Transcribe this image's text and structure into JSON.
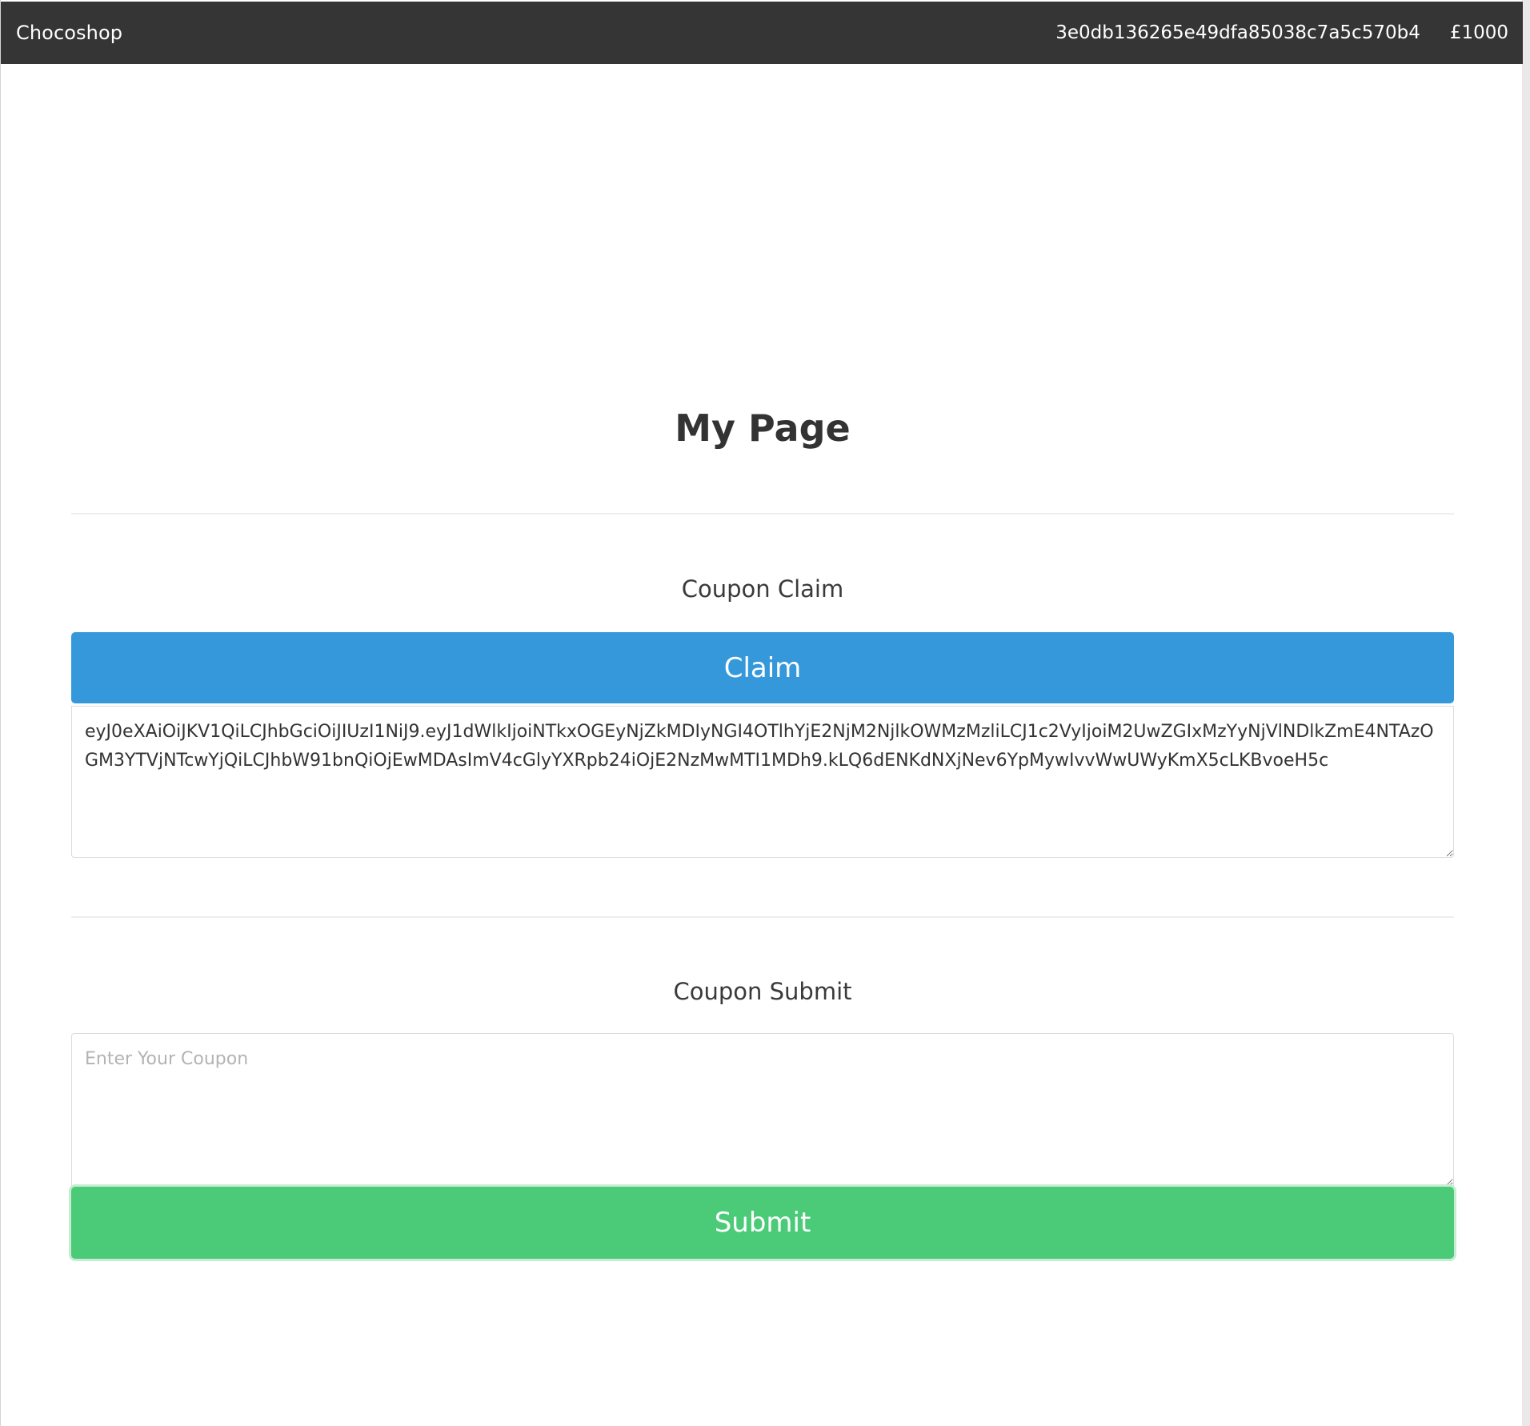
{
  "navbar": {
    "brand": "Chocoshop",
    "user_id": "3e0db136265e49dfa85038c7a5c570b4",
    "balance": "£1000"
  },
  "main": {
    "title": "My Page",
    "claim_section": {
      "heading": "Coupon Claim",
      "button_label": "Claim",
      "token_value": "eyJ0eXAiOiJKV1QiLCJhbGciOiJIUzI1NiJ9.eyJ1dWlkIjoiNTkxOGEyNjZkMDIyNGI4OTlhYjE2NjM2NjlkOWMzMzliLCJ1c2VyIjoiM2UwZGIxMzYyNjVlNDlkZmE4NTAzOGM3YTVjNTcwYjQiLCJhbW91bnQiOjEwMDAsImV4cGlyYXRpb24iOjE2NzMwMTI1MDh9.kLQ6dENKdNXjNev6YpMywIvvWwUWyKmX5cLKBvoeH5c"
    },
    "submit_section": {
      "heading": "Coupon Submit",
      "placeholder": "Enter Your Coupon",
      "value": "",
      "button_label": "Submit"
    }
  }
}
